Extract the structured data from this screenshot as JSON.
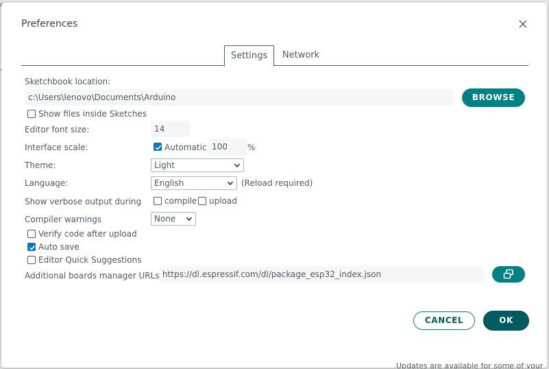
{
  "background": {
    "footer_text": "Updates are available for some of your"
  },
  "dialog": {
    "title": "Preferences",
    "tabs": [
      {
        "label": "Settings",
        "active": true
      },
      {
        "label": "Network",
        "active": false
      }
    ]
  },
  "settings": {
    "sketchbook_label": "Sketchbook location:",
    "sketchbook_value": "c:\\Users\\lenovo\\Documents\\Arduino",
    "browse_label": "BROWSE",
    "show_files_label": "Show files inside Sketches",
    "show_files_checked": false,
    "font_size_label": "Editor font size:",
    "font_size_value": "14",
    "interface_scale_label": "Interface scale:",
    "automatic_label": "Automatic",
    "automatic_checked": true,
    "scale_value": "100",
    "scale_unit": "%",
    "theme_label": "Theme:",
    "theme_value": "Light",
    "language_label": "Language:",
    "language_value": "English",
    "reload_note": "(Reload required)",
    "verbose_label": "Show verbose output during",
    "compile_label": "compile",
    "compile_checked": false,
    "upload_label": "upload",
    "upload_checked": false,
    "compiler_warnings_label": "Compiler warnings",
    "compiler_warnings_value": "None",
    "verify_label": "Verify code after upload",
    "verify_checked": false,
    "autosave_label": "Auto save",
    "autosave_checked": true,
    "quick_suggestions_label": "Editor Quick Suggestions",
    "quick_suggestions_checked": false,
    "boards_urls_label": "Additional boards manager URLs:",
    "boards_urls_value": "https://dl.espressif.com/dl/package_esp32_index.json"
  },
  "footer": {
    "cancel_label": "CANCEL",
    "ok_label": "OK"
  },
  "colors": {
    "accent": "#008184",
    "accent_dark": "#005c5f",
    "checkbox_checked": "#0f75bc",
    "text": "#4e5b61"
  },
  "icons": {
    "close": "close-icon",
    "chevron": "chevron-down-icon",
    "edit_urls": "open-window-icon",
    "check": "check-icon"
  }
}
